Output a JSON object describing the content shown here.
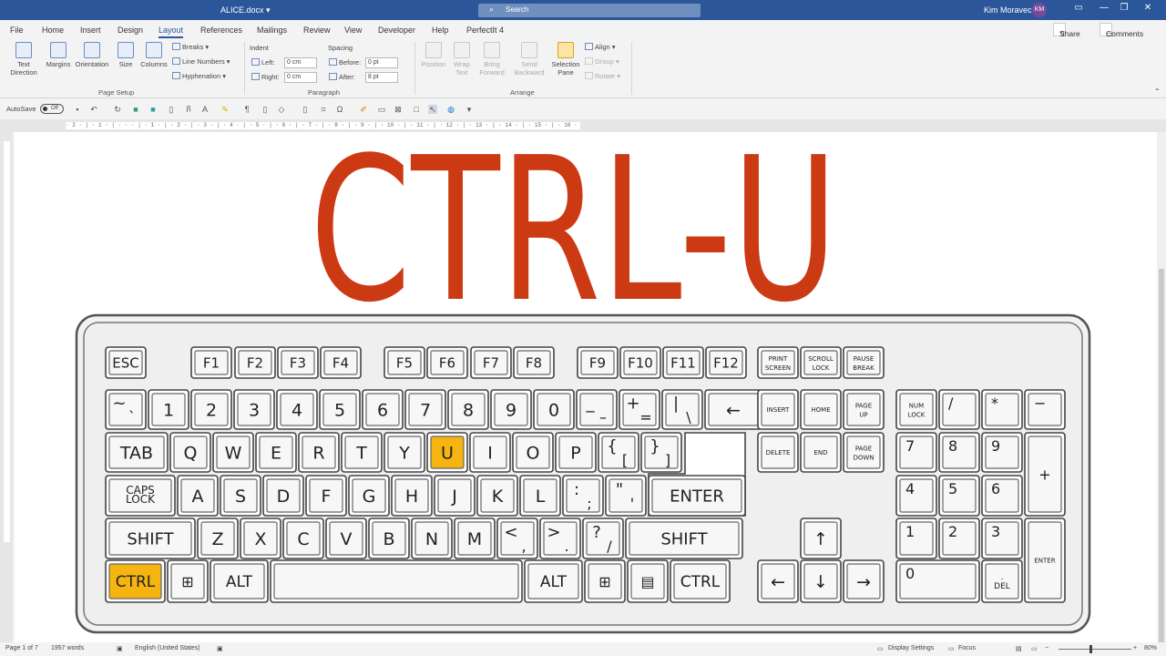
{
  "title_bar": {
    "document": "ALICE.docx",
    "search_placeholder": "Search",
    "user_name": "Kim Moravec",
    "initials": "KM"
  },
  "ribbon_tabs": [
    "File",
    "Home",
    "Insert",
    "Design",
    "Layout",
    "References",
    "Mailings",
    "Review",
    "View",
    "Developer",
    "Help",
    "PerfectIt 4"
  ],
  "active_tab": "Layout",
  "share_label": "Share",
  "comments_label": "Comments",
  "page_setup": {
    "text_direction": "Text Direction",
    "margins": "Margins",
    "orientation": "Orientation",
    "size": "Size",
    "columns": "Columns",
    "breaks": "Breaks",
    "line_numbers": "Line Numbers",
    "hyphenation": "Hyphenation",
    "group_label": "Page Setup"
  },
  "paragraph": {
    "indent_label": "Indent",
    "spacing_label": "Spacing",
    "left_label": "Left:",
    "right_label": "Right:",
    "before_label": "Before:",
    "after_label": "After:",
    "left_value": "0 cm",
    "right_value": "0 cm",
    "before_value": "0 pt",
    "after_value": "8 pt",
    "group_label": "Paragraph"
  },
  "arrange": {
    "position": "Position",
    "wrap_text": "Wrap Text",
    "bring_forward": "Bring Forward",
    "send_backward": "Send Backward",
    "selection_pane": "Selection Pane",
    "align": "Align",
    "group": "Group",
    "rotate": "Rotate",
    "group_label": "Arrange"
  },
  "qat": {
    "autosave": "AutoSave",
    "toggle": "Off"
  },
  "ruler_text": "· 2 · | · 1 · | · · · | · 1 · | · 2 · | · 3 · | · 4 · | · 5 · | · 6 · | · 7 · | · 8 · | · 9 · | · 10 · | · 11 · | · 12 · | · 13 · | · 14 · | · 15 · | · 16 · | · 17 · | · 18 · | · 19 · | · 20 · | · 21 · | · 22 · | · 23 · | · 24 · | · 25 ·",
  "headline": "CTRL-U",
  "colors": {
    "headline": "#cc3a14",
    "highlight": "#f5b40f",
    "word_blue": "#2b579a"
  },
  "keyboard": {
    "fn_row": [
      "ESC",
      "F1",
      "F2",
      "F3",
      "F4",
      "F5",
      "F6",
      "F7",
      "F8",
      "F9",
      "F10",
      "F11",
      "F12"
    ],
    "nav_top": [
      "PRINT SCREEN",
      "SCROLL LOCK",
      "PAUSE BREAK"
    ],
    "num_row": [
      [
        "~",
        "`"
      ],
      [
        "1"
      ],
      [
        "2"
      ],
      [
        "3"
      ],
      [
        "4"
      ],
      [
        "5"
      ],
      [
        "6"
      ],
      [
        "7"
      ],
      [
        "8"
      ],
      [
        "9"
      ],
      [
        "0"
      ],
      [
        "_",
        "–"
      ],
      [
        "+",
        "="
      ],
      [
        "|",
        "\\"
      ],
      [
        "←"
      ]
    ],
    "qwerty_row": [
      "TAB",
      "Q",
      "W",
      "E",
      "R",
      "T",
      "Y",
      "U",
      "I",
      "O",
      "P",
      [
        "{",
        "["
      ],
      [
        "}",
        "]"
      ]
    ],
    "home_row": [
      "CAPS LOCK",
      "A",
      "S",
      "D",
      "F",
      "G",
      "H",
      "J",
      "K",
      "L",
      [
        ":",
        ";"
      ],
      [
        "\"",
        "'"
      ],
      "ENTER"
    ],
    "shift_row": [
      "SHIFT",
      "Z",
      "X",
      "C",
      "V",
      "B",
      "N",
      "M",
      [
        "<",
        ","
      ],
      [
        ">",
        "."
      ],
      [
        "?",
        "/"
      ],
      "SHIFT"
    ],
    "bottom_row": [
      "CTRL",
      "⊞",
      "ALT",
      "",
      "ALT",
      "⊞",
      "▤",
      "CTRL"
    ],
    "nav_mid": [
      "INSERT",
      "HOME",
      "PAGE UP",
      "DELETE",
      "END",
      "PAGE DOWN"
    ],
    "arrows": [
      "↑",
      "←",
      "↓",
      "→"
    ],
    "numpad": [
      "NUM LOCK",
      "/",
      "*",
      "−",
      "7",
      "8",
      "9",
      "+",
      "4",
      "5",
      "6",
      "1",
      "2",
      "3",
      "ENTER",
      "0",
      ".",
      "DEL"
    ],
    "highlighted": [
      "U",
      "CTRL"
    ]
  },
  "status_bar": {
    "page": "Page 1 of 7",
    "words": "1957 words",
    "language": "English (United States)",
    "display_settings": "Display Settings",
    "focus": "Focus",
    "zoom": "80%"
  }
}
